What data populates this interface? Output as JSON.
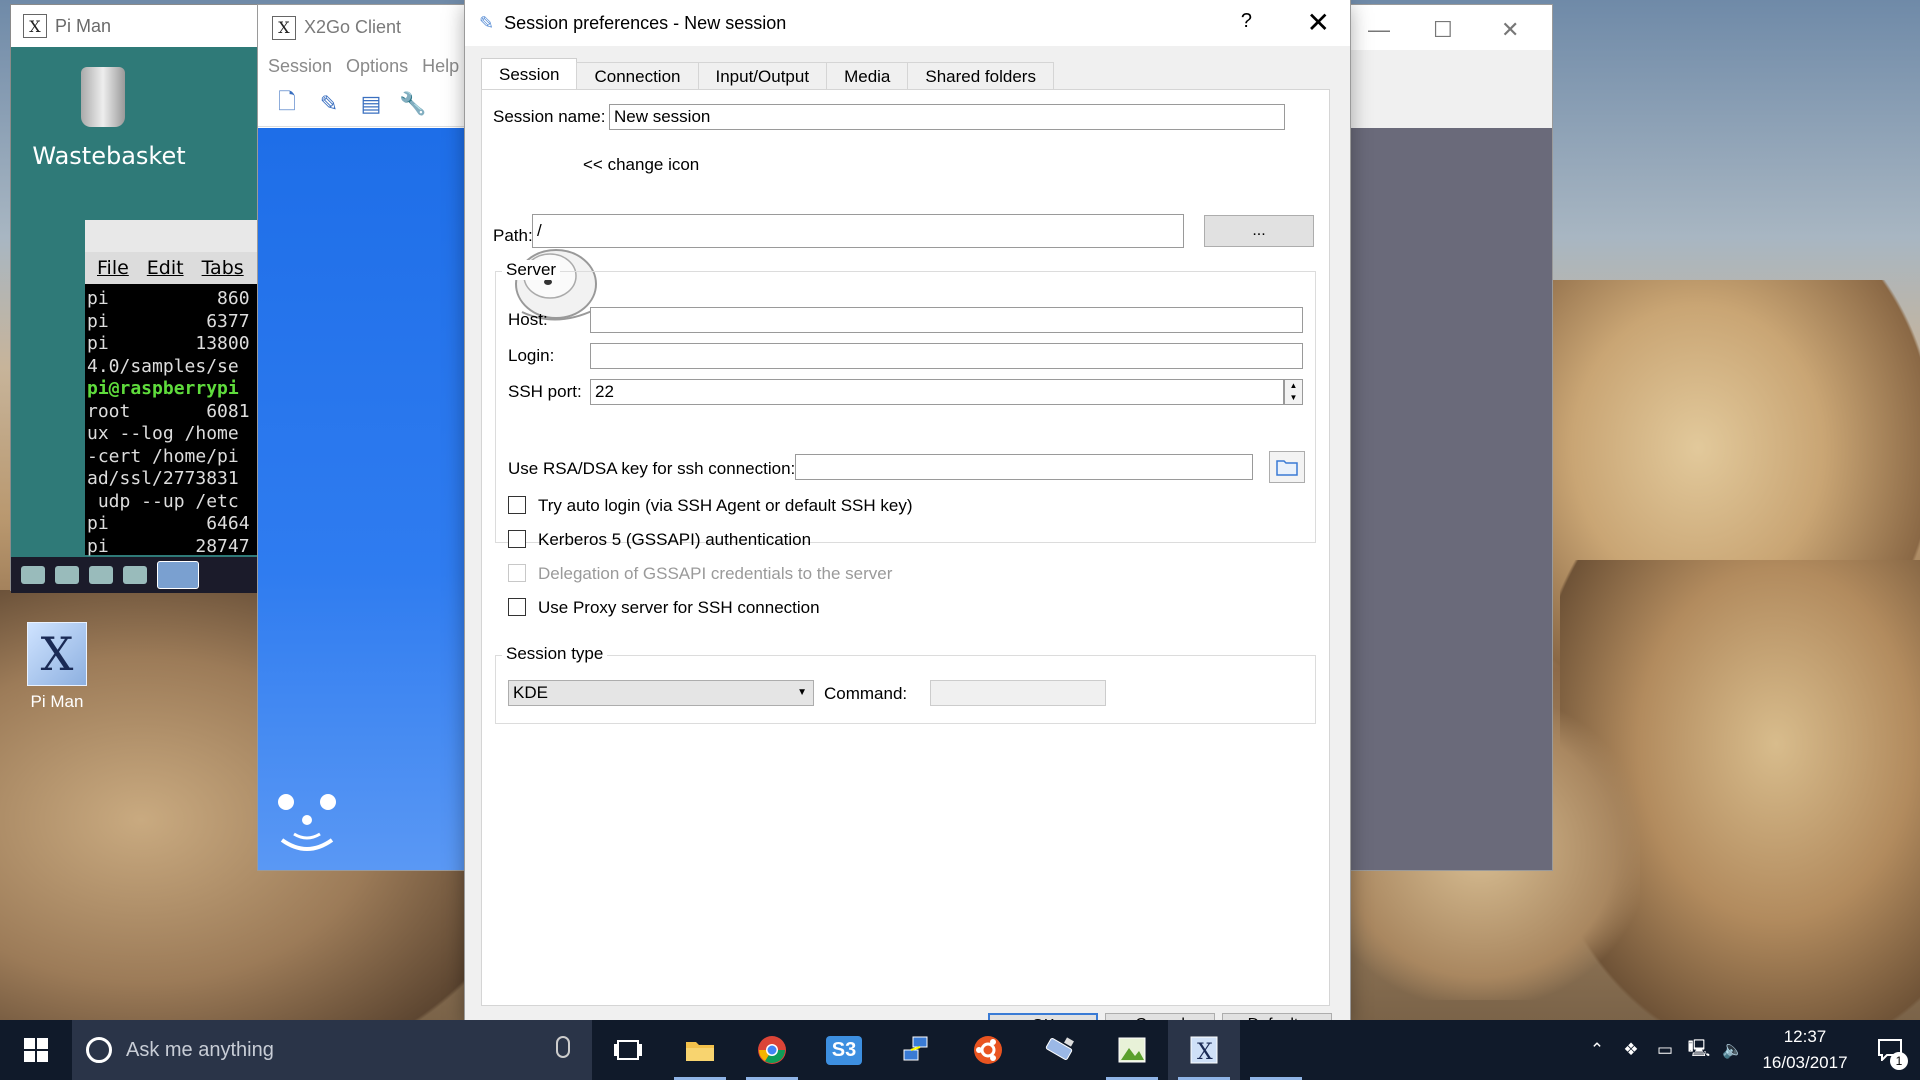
{
  "piman_window": {
    "title": "Pi Man",
    "wastebasket_label": "Wastebasket",
    "terminal": {
      "menu": [
        "File",
        "Edit",
        "Tabs"
      ],
      "lines": [
        "pi          860",
        "pi         6377",
        "pi        13800",
        "4.0/samples/se",
        "pi@raspberrypi",
        "root       6081",
        "ux --log /home",
        "-cert /home/pi",
        "ad/ssl/2773831",
        " udp --up /etc",
        "pi         6464",
        "pi        28747"
      ]
    },
    "desktop_shortcut_label": "Pi Man"
  },
  "x2go_window": {
    "title": "X2Go Client",
    "menu": [
      "Session",
      "Options",
      "Help"
    ]
  },
  "dialog": {
    "title": "Session preferences - New session",
    "help_label": "?",
    "close_label": "✕",
    "tabs": [
      "Session",
      "Connection",
      "Input/Output",
      "Media",
      "Shared folders"
    ],
    "session_name_label": "Session name:",
    "session_name_value": "New session",
    "change_icon_label": "<< change icon",
    "path_label": "Path:",
    "path_value": "/",
    "path_browse_label": "...",
    "server_group_title": "Server",
    "host_label": "Host:",
    "host_value": "",
    "login_label": "Login:",
    "login_value": "",
    "ssh_port_label": "SSH port:",
    "ssh_port_value": "22",
    "rsa_key_label": "Use RSA/DSA key for ssh connection:",
    "rsa_key_value": "",
    "checkboxes": {
      "auto_login": "Try auto login (via SSH Agent or default SSH key)",
      "kerberos": "Kerberos 5 (GSSAPI) authentication",
      "delegation": "Delegation of GSSAPI credentials to the server",
      "proxy": "Use Proxy server for SSH connection"
    },
    "session_type_group_title": "Session type",
    "session_type_value": "KDE",
    "command_label": "Command:",
    "command_value": "",
    "bottom_buttons": [
      "OK",
      "Cancel",
      "Defaults"
    ]
  },
  "taskbar": {
    "search_placeholder": "Ask me anything",
    "apps": [
      "task-view",
      "file-explorer",
      "chrome",
      "s3",
      "network-app",
      "ubuntu",
      "usb-tool",
      "image-viewer",
      "x2go"
    ],
    "s3_label": "S3",
    "clock_time": "12:37",
    "clock_date": "16/03/2017",
    "notification_count": "1"
  },
  "colors": {
    "accent": "#1e6ee8",
    "taskbar": "#101a2a"
  }
}
